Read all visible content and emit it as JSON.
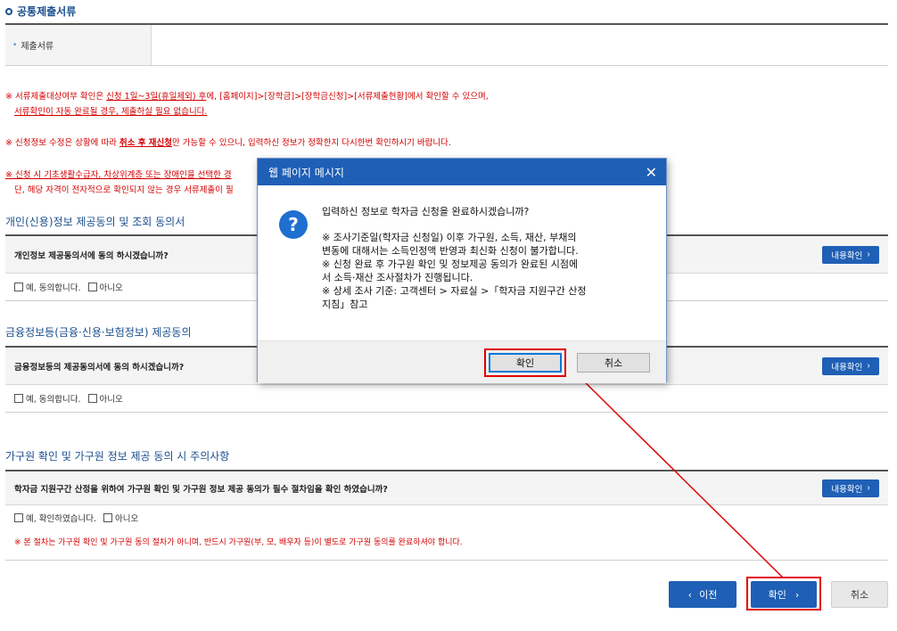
{
  "common_docs": {
    "title": "공통제출서류",
    "row_label": "제출서류"
  },
  "notes": {
    "n1_pre": "※ 서류제출대상여부 확인은 ",
    "n1_ul": "신청 1일~3일(휴일제외) 후",
    "n1_post": "에, [홈페이지]>[장학금]>[장학금신청]>[서류제출현황]에서 확인할 수 있으며,",
    "n1_line2": "서류확인이 자동 완료될 경우, 제출하실 필요 없습니다.",
    "n2_pre": "※ 신청정보 수정은 상황에 따라 ",
    "n2_bold": "취소 후 재신청",
    "n2_post": "만 가능할 수 있으니, 입력하신 정보가 정확한지 다시한번 확인하시기 바랍니다.",
    "n3_line1": "※ 신청 시 기초생활수급자, 차상위계층 또는 장애인을 선택한 경",
    "n3_line2": "단, 해당 자격이 전자적으로 확인되지 않는 경우 서류제출이 필"
  },
  "agreements": [
    {
      "section_title": "개인(신용)정보 제공동의 및 조회 동의서",
      "question": "개인정보 제공동의서에 동의 하시겠습니까?",
      "button": "내용확인",
      "opt_yes": "예, 동의합니다.",
      "opt_no": "아니오"
    },
    {
      "section_title": "금융정보등(금융·신용·보험정보) 제공동의",
      "question": "금융정보등의 제공동의서에 동의 하시겠습니까?",
      "button": "내용확인",
      "opt_yes": "예, 동의합니다.",
      "opt_no": "아니오"
    },
    {
      "section_title": "가구원 확인 및 가구원 정보 제공 동의 시 주의사항",
      "question": "학자금 지원구간 산정을 위하여 가구원 확인 및 가구원 정보 제공 동의가 필수 절차임을 확인 하였습니까?",
      "button": "내용확인",
      "opt_yes": "예, 확인하였습니다.",
      "opt_no": "아니오",
      "warning": "※ 본 절차는 가구원 확인 및 가구원 동의 절차가 아니며, 반드시 가구원(부, 모, 배우자 등)이 별도로 가구원 동의를 완료하셔야 합니다."
    }
  ],
  "bottom_buttons": {
    "prev": "이전",
    "confirm": "확인",
    "cancel": "취소"
  },
  "dialog": {
    "title": "웹 페이지 메시지",
    "question": "입력하신 정보로 학자금 신청을 완료하시겠습니까?",
    "detail": " ※ 조사기준일(학자금 신청일) 이후 가구원, 소득, 재산, 부채의\n변동에 대해서는 소득인정액 반영과 최신화 신청이 불가합니다.\n※ 신청 완료 후 가구원 확인 및 정보제공 동의가 완료된 시점에\n서 소득·재산 조사절차가 진행됩니다.\n※ 상세 조사 기준: 고객센터 > 자료실 >「학자금 지원구간 산정\n지침」참고",
    "ok": "확인",
    "cancel": "취소"
  },
  "colors": {
    "primary_blue": "#1f5fb5",
    "warning_red": "#d40000",
    "highlight_red": "#e00000"
  }
}
